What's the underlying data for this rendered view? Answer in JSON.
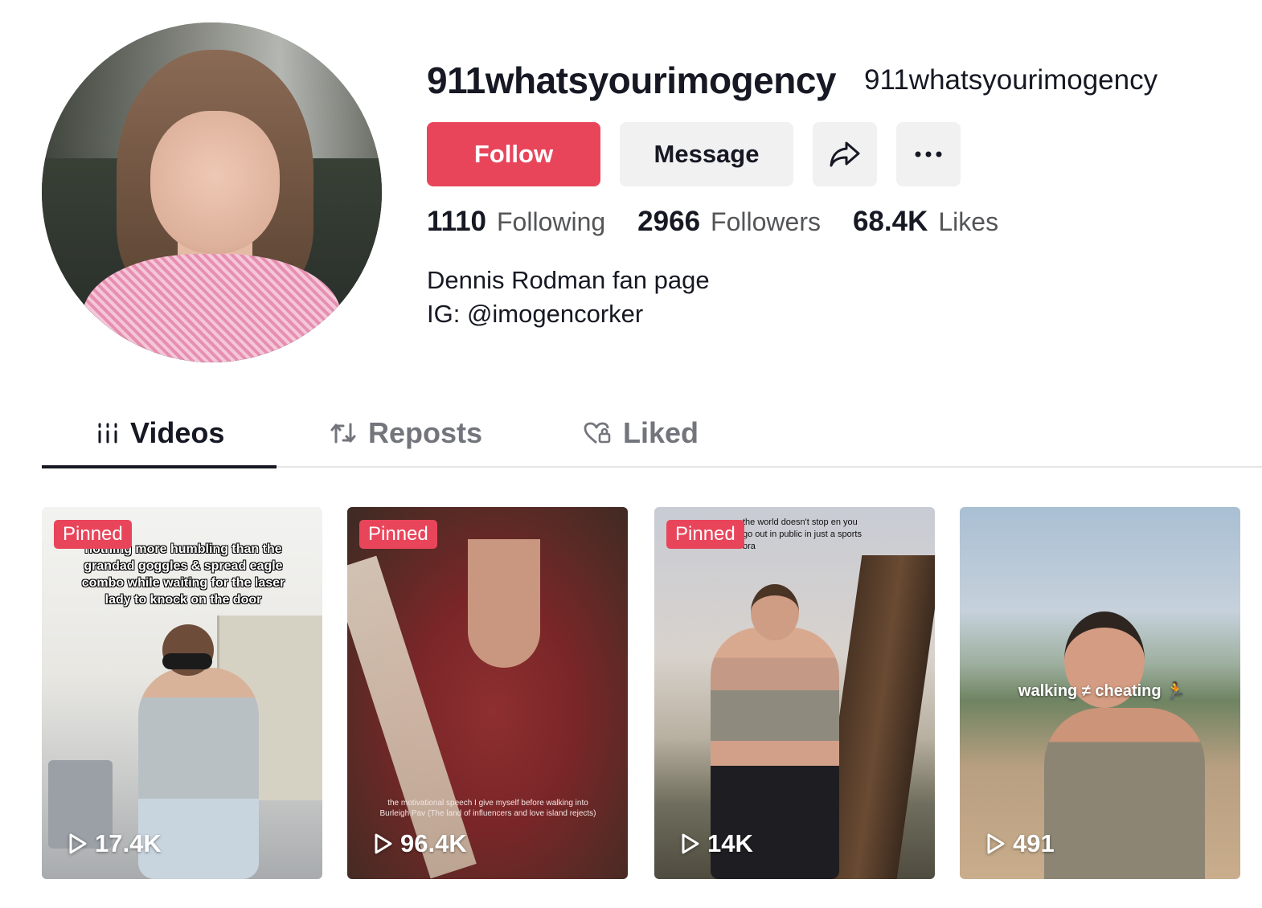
{
  "profile": {
    "username": "911whatsyourimogency",
    "nickname": "911whatsyourimogency",
    "bio_line1": "Dennis Rodman fan page",
    "bio_line2": "IG: @imogencorker"
  },
  "actions": {
    "follow_label": "Follow",
    "message_label": "Message",
    "share_icon": "share-arrow-icon",
    "more_icon": "ellipsis-icon"
  },
  "stats": {
    "following_count": "1110",
    "following_label": "Following",
    "followers_count": "2966",
    "followers_label": "Followers",
    "likes_count": "68.4K",
    "likes_label": "Likes"
  },
  "tabs": [
    {
      "label": "Videos",
      "icon": "grid-icon",
      "active": true
    },
    {
      "label": "Reposts",
      "icon": "repost-icon",
      "active": false
    },
    {
      "label": "Liked",
      "icon": "heart-lock-icon",
      "active": false
    }
  ],
  "videos": [
    {
      "pinned_label": "Pinned",
      "views": "17.4K",
      "caption": "nothing more humbling than the grandad goggles & spread eagle combo while waiting for the laser lady to knock on the door"
    },
    {
      "pinned_label": "Pinned",
      "views": "96.4K",
      "caption": "the motivational speech I give myself before walking into Burleigh Pav (The land of influencers and love island rejects)"
    },
    {
      "pinned_label": "Pinned",
      "views": "14K",
      "caption": "the world doesn't stop en you go out in public in just a sports bra"
    },
    {
      "views": "491",
      "caption": "walking ≠ cheating 🏃"
    }
  ],
  "colors": {
    "accent": "#e8455b",
    "button_gray": "#f1f1f2",
    "text_primary": "#161823",
    "text_secondary": "#545557"
  }
}
